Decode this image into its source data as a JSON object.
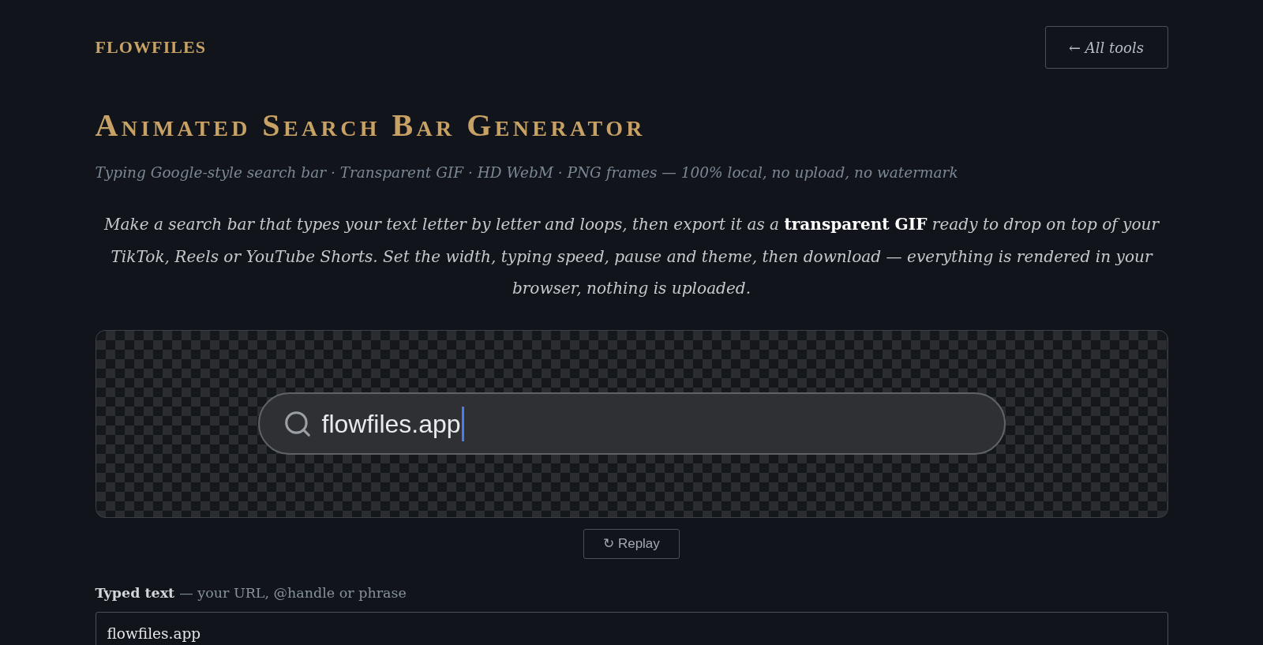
{
  "header": {
    "logo": "FLOWFILES",
    "back_button": "← All tools"
  },
  "title": "Animated Search Bar Generator",
  "subtitle": "Typing Google-style search bar · Transparent GIF · HD WebM · PNG frames — 100% local, no upload, no watermark",
  "intro": "Make a search bar that types your text letter by letter and loops, then export it as a **transparent GIF** ready to drop on top of your TikTok, Reels or YouTube Shorts. Set the width, typing speed, pause and theme, then download — everything is rendered in your browser, nothing is uploaded.",
  "preview": {
    "search_text": "flowfiles.app",
    "caret": true
  },
  "replay_button": "↻ Replay",
  "typed_text_field": {
    "label": "Typed text",
    "hint": "— your URL, @handle or phrase",
    "value": "flowfiles.app"
  }
}
